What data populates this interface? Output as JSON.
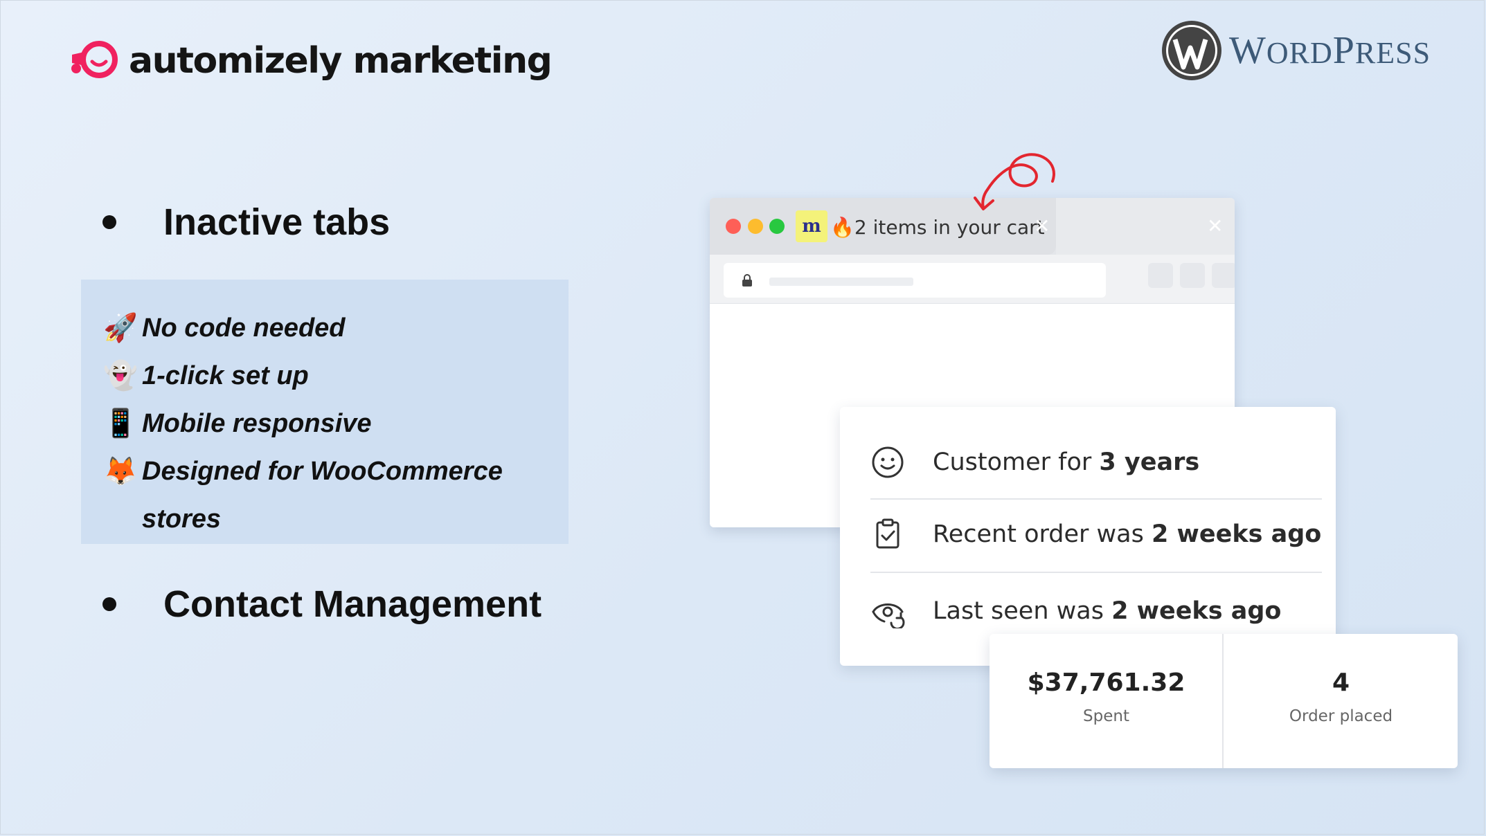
{
  "brand": {
    "name": "automizely marketing",
    "logo_icon": "megaphone-smile-icon",
    "accent": "#f0215f"
  },
  "partner": {
    "first_letter": "W",
    "first_rest": "ORD",
    "second_letter": "P",
    "second_rest": "RESS",
    "logo_icon": "wordpress-logo",
    "color": "#3d5a78"
  },
  "left": {
    "bullets": [
      {
        "label": "Inactive tabs"
      },
      {
        "label": "Contact Management"
      }
    ],
    "features": [
      {
        "emoji": "🚀",
        "text": "No code needed"
      },
      {
        "emoji": "👻",
        "text": "1-click set up"
      },
      {
        "emoji": "📱",
        "text": "Mobile responsive"
      },
      {
        "emoji": "🦊",
        "text": "Designed for WooCommerce stores"
      }
    ]
  },
  "browser": {
    "favicon_letter": "m",
    "tab_title": "🔥2 items in your cart",
    "close_glyph": "✕",
    "traffic_lights": [
      "#fe5f57",
      "#fdbc2e",
      "#28c840"
    ]
  },
  "customer_card": {
    "rows": [
      {
        "icon": "smiley-icon",
        "prefix": "Customer for ",
        "bold": "3 years"
      },
      {
        "icon": "clipboard-check-icon",
        "prefix": "Recent order was ",
        "bold": "2 weeks ago"
      },
      {
        "icon": "eye-refresh-icon",
        "prefix": "Last seen was ",
        "bold": "2 weeks ago"
      }
    ]
  },
  "stats": [
    {
      "value": "$37,761.32",
      "label": "Spent"
    },
    {
      "value": "4",
      "label": "Order placed"
    }
  ]
}
